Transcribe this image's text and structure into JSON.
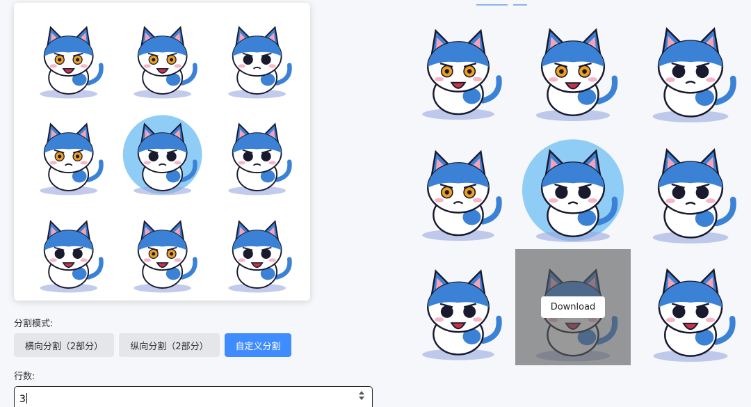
{
  "split_mode": {
    "label": "分割模式:",
    "options": [
      {
        "label": "横向分割（2部分）",
        "active": false
      },
      {
        "label": "纵向分割（2部分）",
        "active": false
      },
      {
        "label": "自定义分割",
        "active": true
      }
    ]
  },
  "rows": {
    "label": "行数:",
    "value": "3"
  },
  "result_grid": {
    "download_label": "Download",
    "hovered_cell": 7
  },
  "colors": {
    "accent": "#3f8cff",
    "cat_blue": "#3b82d6",
    "cat_dark_blue": "#2a5fb0",
    "page_bg": "#f5f7fa"
  },
  "stickers": [
    {
      "name": "cat-waving-shouting",
      "icon": "cat-sticker"
    },
    {
      "name": "cat-surprised",
      "icon": "cat-sticker"
    },
    {
      "name": "cat-frowning",
      "icon": "cat-sticker"
    },
    {
      "name": "cat-annoyed",
      "icon": "cat-sticker"
    },
    {
      "name": "cat-angry-bubble",
      "icon": "cat-sticker"
    },
    {
      "name": "cat-crying",
      "icon": "cat-sticker"
    },
    {
      "name": "cat-yelling",
      "icon": "cat-sticker"
    },
    {
      "name": "cat-shocked",
      "icon": "cat-sticker"
    },
    {
      "name": "cat-shouting-angry",
      "icon": "cat-sticker"
    }
  ]
}
